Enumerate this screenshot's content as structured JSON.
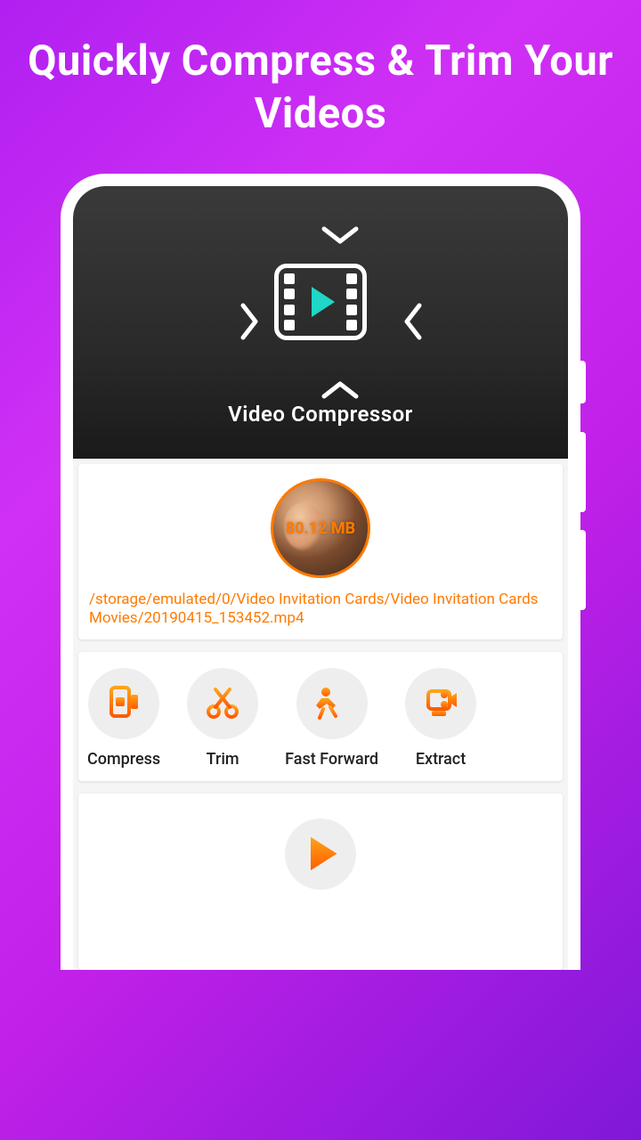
{
  "headline": "Quickly Compress & Trim Your Videos",
  "hero": {
    "title": "Video Compressor"
  },
  "video": {
    "size_label": "80.12 MB",
    "path": "/storage/emulated/0/Video Invitation Cards/Video Invitation Cards Movies/20190415_153452.mp4"
  },
  "actions": [
    {
      "label": "Compress",
      "icon": "compress-icon"
    },
    {
      "label": "Trim",
      "icon": "scissors-icon"
    },
    {
      "label": "Fast Forward",
      "icon": "fast-forward-icon"
    },
    {
      "label": "Extract",
      "icon": "extract-icon"
    }
  ],
  "colors": {
    "accent": "#ff7a00",
    "teal": "#1ed7c7"
  }
}
